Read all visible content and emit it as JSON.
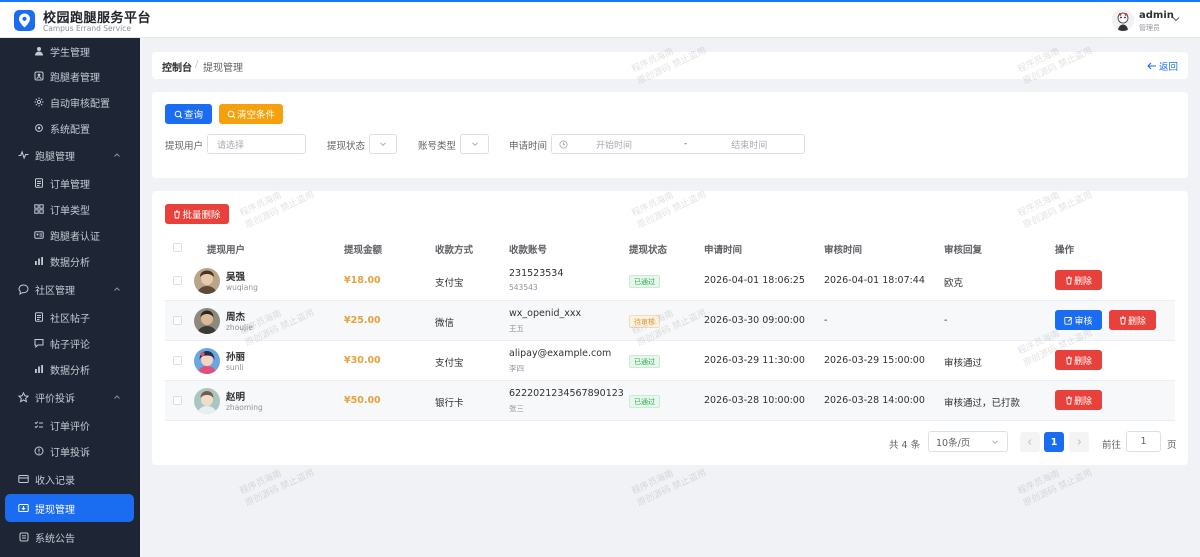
{
  "app": {
    "title": "校园跑腿服务平台",
    "subtitle": "Campus Errand Service"
  },
  "user": {
    "name": "admin",
    "role": "管理员"
  },
  "sidebar": {
    "items": [
      {
        "label": "学生管理",
        "icon": "user-icon",
        "level": "sub"
      },
      {
        "label": "跑腿者管理",
        "icon": "runner-icon",
        "level": "sub"
      },
      {
        "label": "自动审核配置",
        "icon": "gear-icon",
        "level": "sub"
      },
      {
        "label": "系统配置",
        "icon": "cog-icon",
        "level": "sub"
      },
      {
        "label": "跑腿管理",
        "icon": "pulse-icon",
        "level": "group"
      },
      {
        "label": "订单管理",
        "icon": "document-icon",
        "level": "sub"
      },
      {
        "label": "订单类型",
        "icon": "grid-icon",
        "level": "sub"
      },
      {
        "label": "跑腿者认证",
        "icon": "idcard-icon",
        "level": "sub"
      },
      {
        "label": "数据分析",
        "icon": "bar-chart-icon",
        "level": "sub"
      },
      {
        "label": "社区管理",
        "icon": "chat-icon",
        "level": "group"
      },
      {
        "label": "社区帖子",
        "icon": "document-icon",
        "level": "sub"
      },
      {
        "label": "帖子评论",
        "icon": "comment-icon",
        "level": "sub"
      },
      {
        "label": "数据分析",
        "icon": "bar-chart-icon",
        "level": "sub"
      },
      {
        "label": "评价投诉",
        "icon": "star-icon",
        "level": "group"
      },
      {
        "label": "订单评价",
        "icon": "checklist-icon",
        "level": "sub"
      },
      {
        "label": "订单投诉",
        "icon": "alert-icon",
        "level": "sub"
      },
      {
        "label": "收入记录",
        "icon": "card-icon",
        "level": "top"
      },
      {
        "label": "提现管理",
        "icon": "withdraw-icon",
        "level": "top",
        "active": true
      },
      {
        "label": "系统公告",
        "icon": "bell-icon",
        "level": "top"
      }
    ]
  },
  "breadcrumb": {
    "home": "控制台",
    "separator": "/",
    "current": "提现管理",
    "back": "返回"
  },
  "filters": {
    "query_label": "查询",
    "clear_label": "清空条件",
    "user_label": "提现用户",
    "user_placeholder": "请选择",
    "status_label": "提现状态",
    "account_type_label": "账号类型",
    "apply_time_label": "申请时间",
    "start_placeholder": "开始时间",
    "range_sep": "-",
    "end_placeholder": "结束时间"
  },
  "table": {
    "batch_delete_label": "批量删除",
    "columns": [
      "提现用户",
      "提现金额",
      "收款方式",
      "收款账号",
      "提现状态",
      "申请时间",
      "审核时间",
      "审核回复",
      "操作"
    ],
    "rows": [
      {
        "name": "吴强",
        "login": "wuqiang",
        "amount": "¥18.00",
        "method": "支付宝",
        "account": "231523534",
        "account_name": "543543",
        "status": "已通过",
        "status_type": "ok",
        "apply_time": "2026-04-01 18:06:25",
        "review_time": "2026-04-01 18:07:44",
        "reply": "欧克",
        "actions": [
          "删除"
        ]
      },
      {
        "name": "周杰",
        "login": "zhoujie",
        "amount": "¥25.00",
        "method": "微信",
        "account": "wx_openid_xxx",
        "account_name": "王五",
        "status": "待审核",
        "status_type": "pending",
        "apply_time": "2026-03-30 09:00:00",
        "review_time": "-",
        "reply": "-",
        "actions": [
          "审核",
          "删除"
        ]
      },
      {
        "name": "孙丽",
        "login": "sunli",
        "amount": "¥30.00",
        "method": "支付宝",
        "account": "alipay@example.com",
        "account_name": "李四",
        "status": "已通过",
        "status_type": "ok",
        "apply_time": "2026-03-29 11:30:00",
        "review_time": "2026-03-29 15:00:00",
        "reply": "审核通过",
        "actions": [
          "删除"
        ]
      },
      {
        "name": "赵明",
        "login": "zhaoming",
        "amount": "¥50.00",
        "method": "银行卡",
        "account": "6222021234567890123",
        "account_name": "张三",
        "status": "已通过",
        "status_type": "ok",
        "apply_time": "2026-03-28 10:00:00",
        "review_time": "2026-03-28 14:00:00",
        "reply": "审核通过，已打款",
        "actions": [
          "删除"
        ]
      }
    ]
  },
  "pagination": {
    "total": "共 4 条",
    "page_size": "10条/页",
    "current_page": "1",
    "goto_label": "前往",
    "goto_value": "1",
    "page_unit": "页"
  },
  "watermark": {
    "line1": "程序员海南",
    "line2": "原创源码 禁止盗用"
  },
  "colors": {
    "primary": "#1a6cf0",
    "warning": "#f5a10e",
    "danger": "#e8413c",
    "sidebar_bg": "#1e2535",
    "amount": "#e6a23c",
    "success": "#27b148"
  }
}
